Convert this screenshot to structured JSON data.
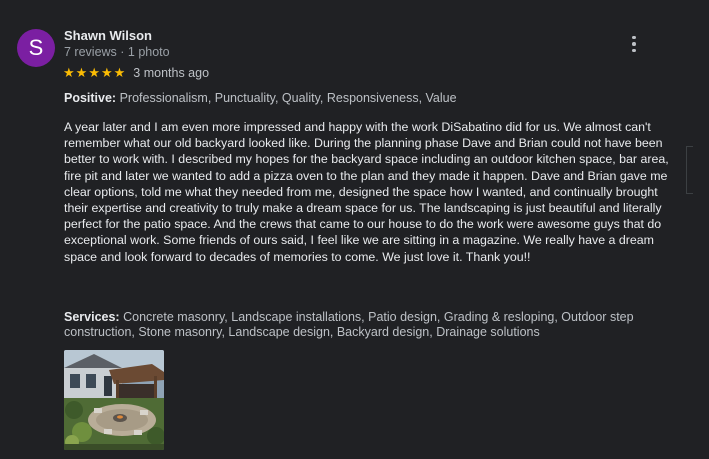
{
  "review": {
    "avatar_letter": "S",
    "author": "Shawn Wilson",
    "meta": "7 reviews · 1 photo",
    "rating": 5,
    "stars": [
      "★",
      "★",
      "★",
      "★",
      "★"
    ],
    "time_ago": "3 months ago",
    "positive_label": "Positive:",
    "positive_text": "Professionalism, Punctuality, Quality, Responsiveness, Value",
    "body": "A year later and I am even more impressed and happy with the work DiSabatino did for us.  We almost can't remember what our old backyard looked like.  During the planning phase Dave and Brian could not have been better to work with.  I described my hopes for the backyard space including an outdoor kitchen space, bar area, fire pit and later we wanted to add a pizza oven to the plan and they made it happen.  Dave and Brian gave me clear options, told me what they needed from me, designed the space how I wanted, and continually brought their expertise and creativity to truly make a dream space for us.  The landscaping is just beautiful and literally perfect for the patio space.  And the crews that came to our house to do the work were awesome guys that do exceptional work.  Some friends of ours said, I feel like we are sitting in a magazine.  We really have a dream space and look forward to decades of memories to come.  We just love it.  Thank you!!",
    "services_label": "Services:",
    "services_text": "Concrete masonry, Landscape installations, Patio design, Grading & resloping, Outdoor step construction, Stone masonry, Landscape design, Backyard design, Drainage solutions",
    "photo_icon": "backyard-patio-photo"
  },
  "colors": {
    "background": "#202124",
    "avatar": "#7b1fa2",
    "star": "#fbbc04",
    "text_primary": "#e8eaed",
    "text_secondary": "#bdc1c6"
  }
}
